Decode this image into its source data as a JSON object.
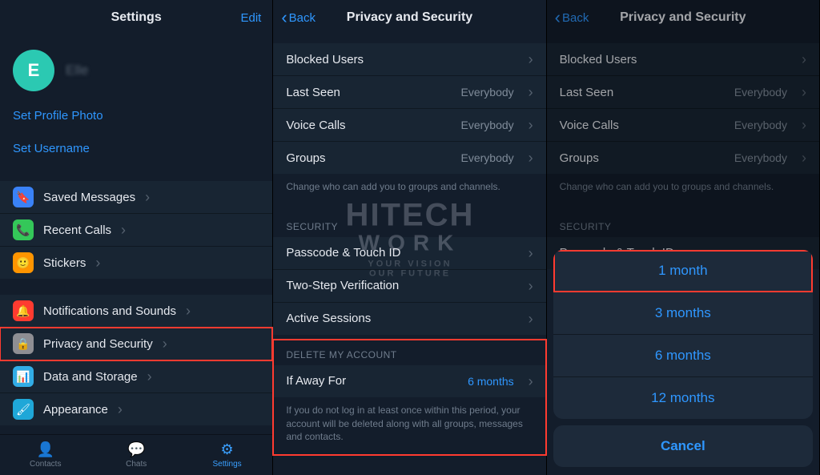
{
  "watermark": {
    "line1": "HITECH",
    "line2": "WORK",
    "tag1": "YOUR VISION",
    "tag2": "OUR FUTURE"
  },
  "p1": {
    "title": "Settings",
    "edit": "Edit",
    "avatar_initial": "E",
    "name": "Elle",
    "set_photo": "Set Profile Photo",
    "set_username": "Set Username",
    "items_a": [
      {
        "icon": "bookmark-icon",
        "cls": "i-blue",
        "glyph": "🔖",
        "label": "Saved Messages"
      },
      {
        "icon": "phone-icon",
        "cls": "i-green",
        "glyph": "📞",
        "label": "Recent Calls"
      },
      {
        "icon": "sticker-icon",
        "cls": "i-orange",
        "glyph": "🙂",
        "label": "Stickers"
      }
    ],
    "items_b": [
      {
        "icon": "bell-icon",
        "cls": "i-red",
        "glyph": "🔔",
        "label": "Notifications and Sounds",
        "hl": false
      },
      {
        "icon": "lock-icon",
        "cls": "i-grey",
        "glyph": "🔒",
        "label": "Privacy and Security",
        "hl": true
      },
      {
        "icon": "data-icon",
        "cls": "i-teal",
        "glyph": "📊",
        "label": "Data and Storage",
        "hl": false
      },
      {
        "icon": "brush-icon",
        "cls": "i-cyan",
        "glyph": "🖌",
        "label": "Appearance",
        "hl": false
      }
    ],
    "tabs": [
      {
        "icon": "👤",
        "label": "Contacts",
        "active": false
      },
      {
        "icon": "💬",
        "label": "Chats",
        "active": false
      },
      {
        "icon": "⚙︎",
        "label": "Settings",
        "active": true
      }
    ]
  },
  "p2": {
    "back": "Back",
    "title": "Privacy and Security",
    "privacy_rows": [
      {
        "label": "Blocked Users",
        "val": ""
      },
      {
        "label": "Last Seen",
        "val": "Everybody"
      },
      {
        "label": "Voice Calls",
        "val": "Everybody"
      },
      {
        "label": "Groups",
        "val": "Everybody"
      }
    ],
    "privacy_foot": "Change who can add you to groups and channels.",
    "security_head": "SECURITY",
    "security_rows": [
      {
        "label": "Passcode & Touch ID"
      },
      {
        "label": "Two-Step Verification"
      },
      {
        "label": "Active Sessions"
      }
    ],
    "delete_head": "DELETE MY ACCOUNT",
    "away": {
      "label": "If Away For",
      "val": "6 months"
    },
    "delete_foot": "If you do not log in at least once within this period, your account will be deleted along with all groups, messages and contacts."
  },
  "p3": {
    "back": "Back",
    "title": "Privacy and Security",
    "privacy_rows": [
      {
        "label": "Blocked Users",
        "val": ""
      },
      {
        "label": "Last Seen",
        "val": "Everybody"
      },
      {
        "label": "Voice Calls",
        "val": "Everybody"
      },
      {
        "label": "Groups",
        "val": "Everybody"
      }
    ],
    "privacy_foot": "Change who can add you to groups and channels.",
    "security_head": "SECURITY",
    "security_row": "Passcode & Touch ID",
    "options": [
      "1 month",
      "3 months",
      "6 months",
      "12 months"
    ],
    "cancel": "Cancel"
  }
}
